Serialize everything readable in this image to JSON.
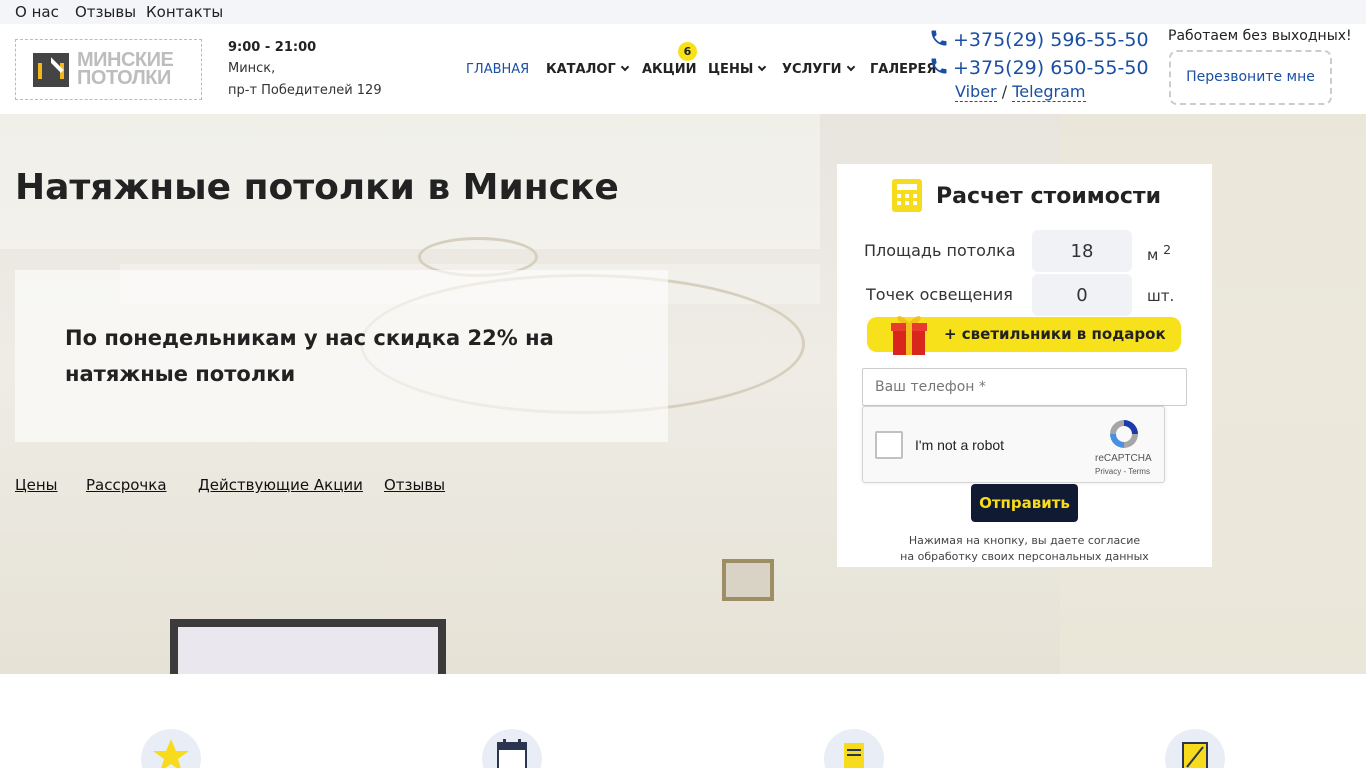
{
  "topbar": {
    "links": [
      "О нас",
      "Отзывы",
      "Контакты"
    ]
  },
  "header": {
    "logo": {
      "line1": "МИНСКИЕ",
      "line2": "ПОТОЛКИ"
    },
    "hours": "9:00 - 21:00",
    "address_line1": "Минск,",
    "address_line2": "пр-т Победителей 129",
    "nav": [
      {
        "label": "ГЛАВНАЯ",
        "active": true
      },
      {
        "label": "КАТАЛОГ",
        "dropdown": true
      },
      {
        "label": "АКЦИИ",
        "badge": "6"
      },
      {
        "label": "ЦЕНЫ",
        "dropdown": true
      },
      {
        "label": "УСЛУГИ",
        "dropdown": true
      },
      {
        "label": "ГАЛЕРЕЯ"
      }
    ],
    "phones": [
      "+375(29) 596-55-50",
      "+375(29) 650-55-50"
    ],
    "messengers": {
      "viber": "Viber",
      "separator": "/",
      "telegram": "Telegram"
    },
    "work_days": "Работаем без выходных!",
    "callback_label": "Перезвоните мне"
  },
  "hero": {
    "title": "Натяжные потолки в Минске",
    "promo": "По понедельникам у нас скидка 22% на натяжные потолки",
    "links": [
      "Цены",
      "Рассрочка",
      "Действующие Акции",
      "Отзывы"
    ]
  },
  "calculator": {
    "title": "Расчет стоимости",
    "area_label": "Площадь потолка",
    "area_value": "18",
    "area_unit": "м",
    "area_unit_sup": "2",
    "lights_label": "Точек освещения",
    "lights_value": "0",
    "lights_unit": "шт.",
    "gift": "+ светильники в подарок",
    "phone_placeholder": "Ваш телефон *",
    "captcha": {
      "label": "I'm not a robot",
      "brand": "reCAPTCHA",
      "terms": "Privacy - Terms"
    },
    "submit": "Отправить",
    "consent_line1": "Нажимая на кнопку, вы даете согласие",
    "consent_line2": "на обработку своих персональных данных"
  },
  "colors": {
    "accent_blue": "#1a4fa3",
    "accent_yellow": "#f7e11a",
    "dark_button": "#111a33"
  },
  "features_icons": [
    "star-icon",
    "calendar-icon",
    "document-icon",
    "chart-icon"
  ]
}
